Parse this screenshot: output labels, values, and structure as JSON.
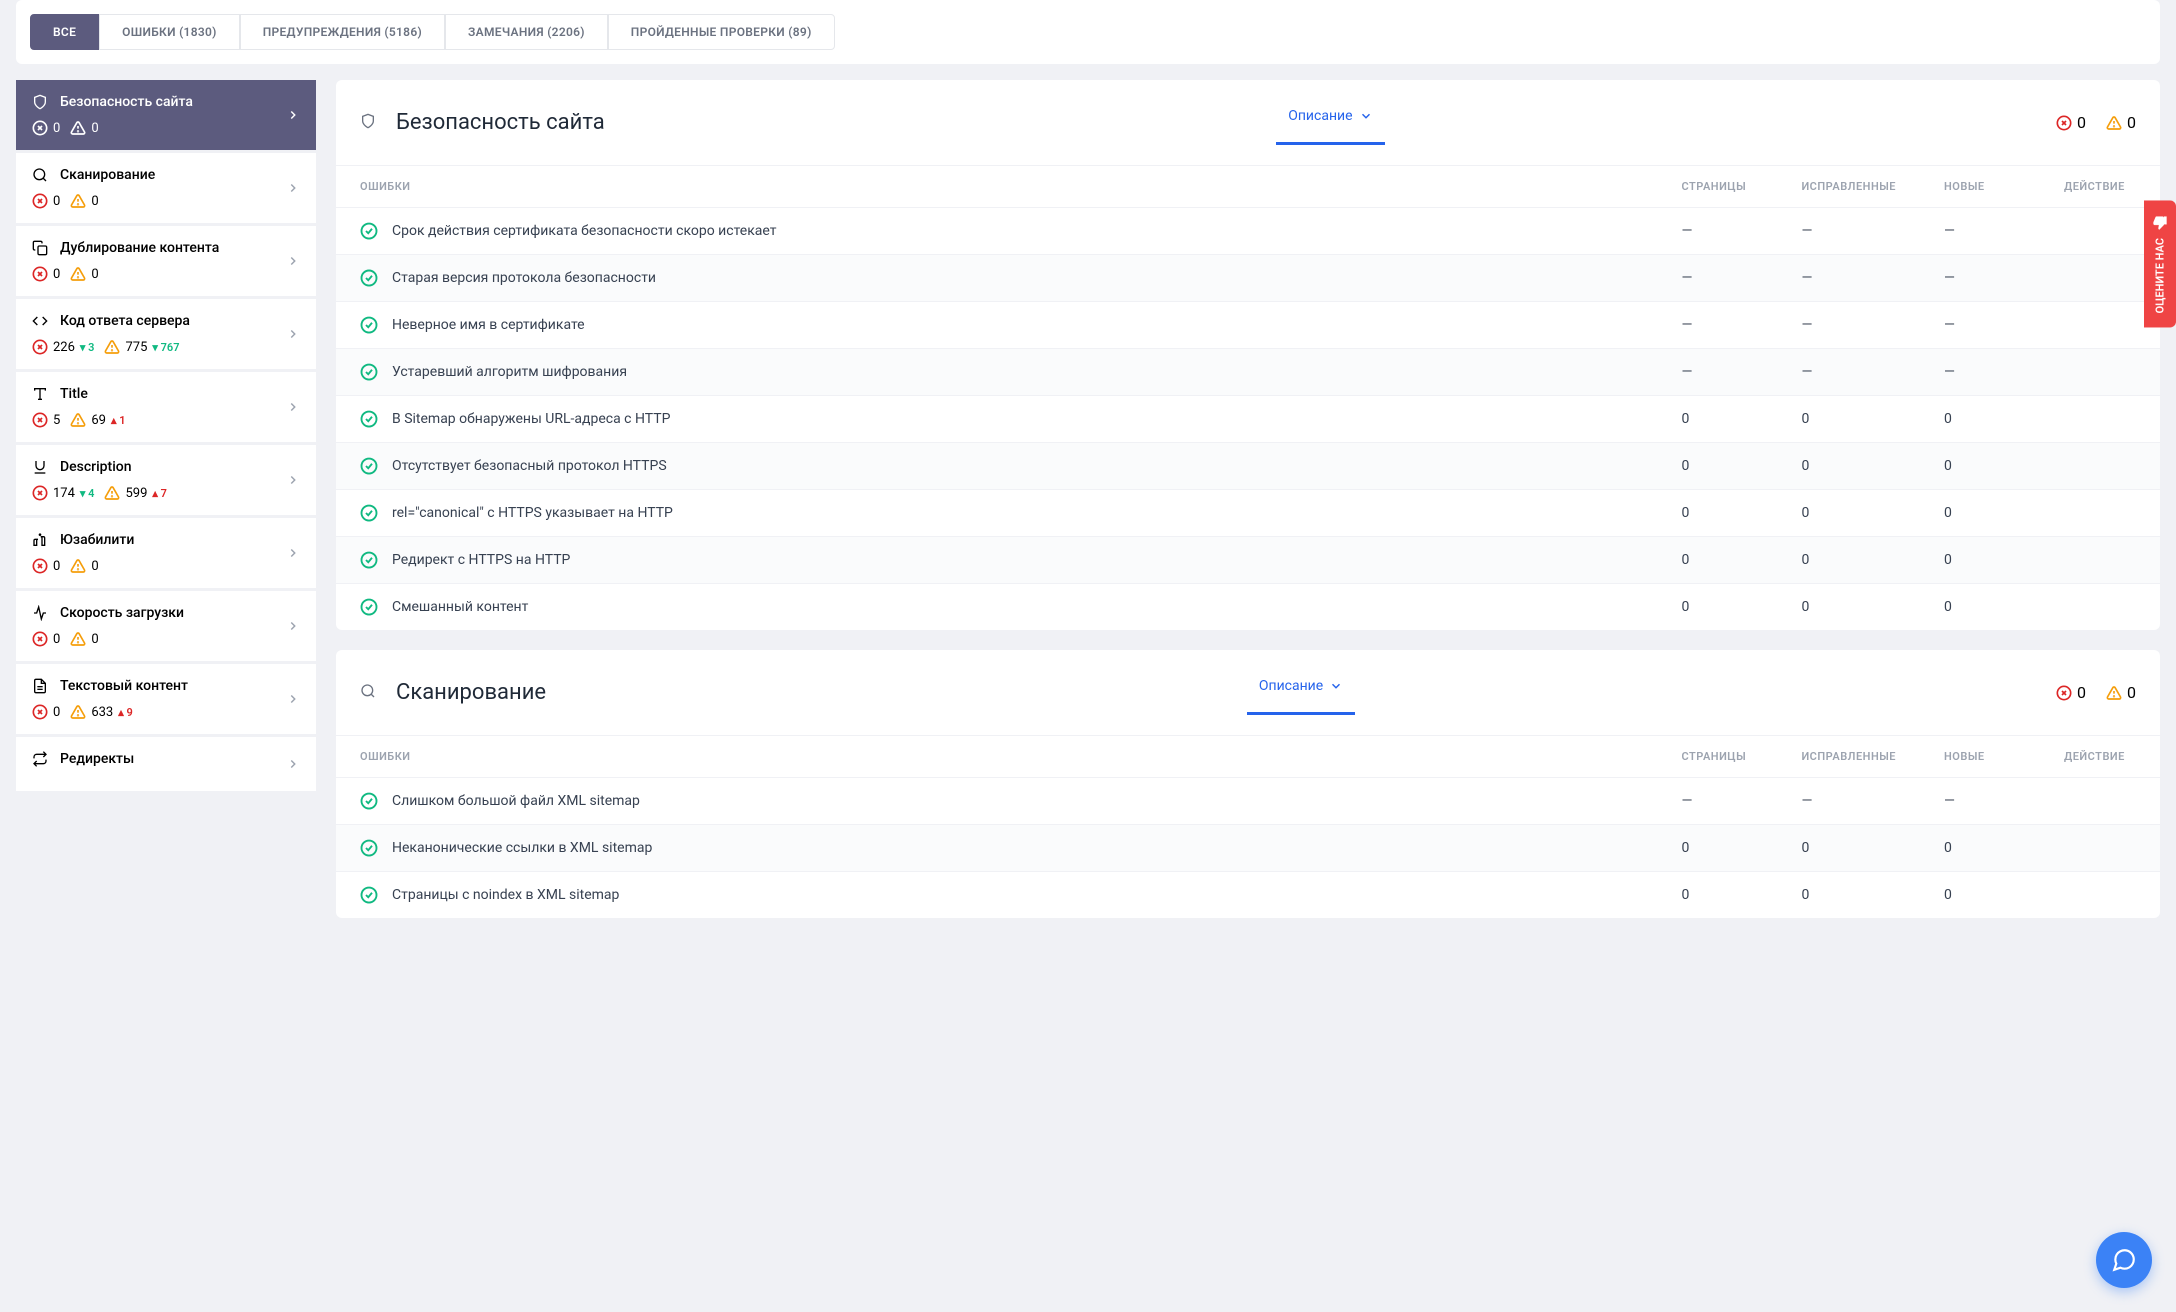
{
  "tabs": [
    {
      "label": "ВСЕ",
      "active": true
    },
    {
      "label": "ОШИБКИ (1830)"
    },
    {
      "label": "ПРЕДУПРЕЖДЕНИЯ (5186)"
    },
    {
      "label": "ЗАМЕЧАНИЯ (2206)"
    },
    {
      "label": "ПРОЙДЕННЫЕ ПРОВЕРКИ (89)"
    }
  ],
  "sidebar": [
    {
      "icon": "shield",
      "label": "Безопасность сайта",
      "err": "0",
      "warn": "0",
      "active": true
    },
    {
      "icon": "search",
      "label": "Сканирование",
      "err": "0",
      "warn": "0"
    },
    {
      "icon": "copy",
      "label": "Дублирование контента",
      "err": "0",
      "warn": "0"
    },
    {
      "icon": "code",
      "label": "Код ответа сервера",
      "err": "226",
      "errDelta": "3",
      "errDir": "down",
      "warn": "775",
      "warnDelta": "767",
      "warnDir": "down"
    },
    {
      "icon": "type",
      "label": "Title",
      "err": "5",
      "warn": "69",
      "warnDelta": "1",
      "warnDir": "up"
    },
    {
      "icon": "underline",
      "label": "Description",
      "err": "174",
      "errDelta": "4",
      "errDir": "down",
      "warn": "599",
      "warnDelta": "7",
      "warnDir": "up"
    },
    {
      "icon": "sparkle",
      "label": "Юзабилити",
      "err": "0",
      "warn": "0"
    },
    {
      "icon": "speed",
      "label": "Скорость загрузки",
      "err": "0",
      "warn": "0"
    },
    {
      "icon": "text",
      "label": "Текстовый контент",
      "err": "0",
      "warn": "633",
      "warnDelta": "9",
      "warnDir": "up"
    },
    {
      "icon": "redirect",
      "label": "Редиректы"
    }
  ],
  "sections": [
    {
      "icon": "shield",
      "title": "Безопасность сайта",
      "descLabel": "Описание",
      "err": "0",
      "warn": "0",
      "cols": [
        "ОШИБКИ",
        "СТРАНИЦЫ",
        "ИСПРАВЛЕННЫЕ",
        "НОВЫЕ",
        "ДЕЙСТВИЕ"
      ],
      "rows": [
        {
          "name": "Срок действия сертификата безопасности скоро истекает",
          "p": "—",
          "f": "—",
          "n": "—"
        },
        {
          "name": "Старая версия протокола безопасности",
          "p": "—",
          "f": "—",
          "n": "—"
        },
        {
          "name": "Неверное имя в сертификате",
          "p": "—",
          "f": "—",
          "n": "—"
        },
        {
          "name": "Устаревший алгоритм шифрования",
          "p": "—",
          "f": "—",
          "n": "—"
        },
        {
          "name": "В Sitemap обнаружены URL-адреса с HTTP",
          "p": "0",
          "f": "0",
          "n": "0"
        },
        {
          "name": "Отсутствует безопасный протокол HTTPS",
          "p": "0",
          "f": "0",
          "n": "0"
        },
        {
          "name": "rel=\"canonical\" с HTTPS указывает на HTTP",
          "p": "0",
          "f": "0",
          "n": "0"
        },
        {
          "name": "Редирект с HTTPS на HTTP",
          "p": "0",
          "f": "0",
          "n": "0"
        },
        {
          "name": "Смешанный контент",
          "p": "0",
          "f": "0",
          "n": "0"
        }
      ]
    },
    {
      "icon": "search",
      "title": "Сканирование",
      "descLabel": "Описание",
      "err": "0",
      "warn": "0",
      "cols": [
        "ОШИБКИ",
        "СТРАНИЦЫ",
        "ИСПРАВЛЕННЫЕ",
        "НОВЫЕ",
        "ДЕЙСТВИЕ"
      ],
      "rows": [
        {
          "name": "Слишком большой файл XML sitemap",
          "p": "—",
          "f": "—",
          "n": "—"
        },
        {
          "name": "Неканонические ссылки в XML sitemap",
          "p": "0",
          "f": "0",
          "n": "0"
        },
        {
          "name": "Страницы с noindex в XML sitemap",
          "p": "0",
          "f": "0",
          "n": "0"
        }
      ]
    }
  ],
  "feedback": "ОЦЕНИТЕ НАС"
}
